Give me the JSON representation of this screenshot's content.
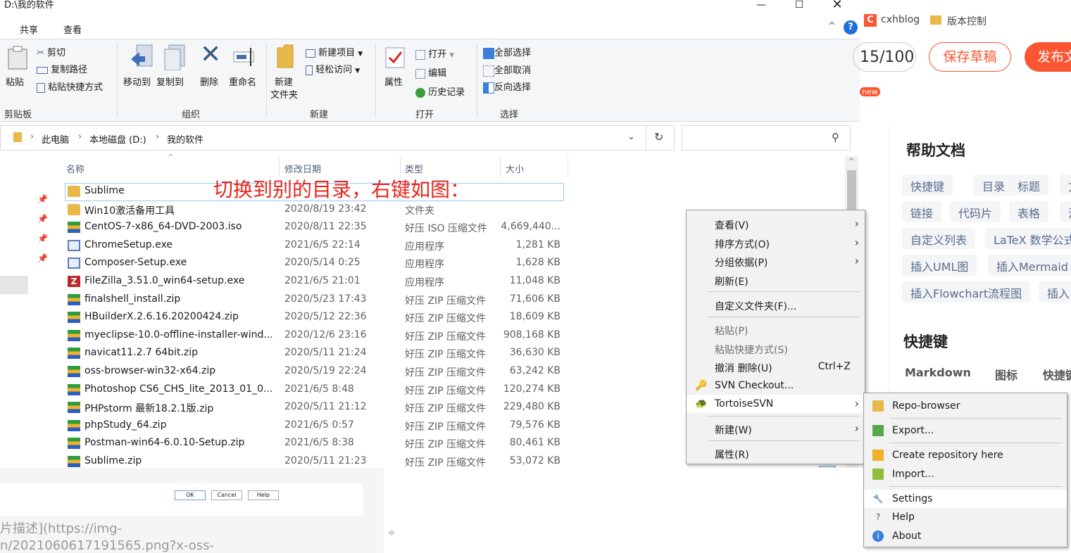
{
  "window": {
    "title": "D:\\我的软件",
    "min_icon": "minimize-icon",
    "max_icon": "maximize-icon",
    "close_icon": "close-icon"
  },
  "ribbon_tabs": [
    "共享",
    "查看"
  ],
  "ribbon": {
    "clipboard": {
      "paste": "粘贴",
      "cut": "剪切",
      "copy_path": "复制路径",
      "paste_shortcut": "粘贴快捷方式",
      "label": "剪贴板"
    },
    "organize": {
      "move_to": "移动到",
      "copy_to": "复制到",
      "delete": "删除",
      "rename": "重命名",
      "label": "组织"
    },
    "new": {
      "new_folder_l1": "新建",
      "new_folder_l2": "文件夹",
      "new_item": "新建项目",
      "easy_access": "轻松访问",
      "label": "新建"
    },
    "open": {
      "properties": "属性",
      "open": "打开",
      "edit": "编辑",
      "history": "历史记录",
      "label": "打开"
    },
    "select": {
      "select_all": "全部选择",
      "select_none": "全部取消",
      "invert": "反向选择",
      "label": "选择"
    }
  },
  "address": {
    "crumbs": [
      "此电脑",
      "本地磁盘 (D:)",
      "我的软件"
    ],
    "search_placeholder": ""
  },
  "columns": {
    "name": "名称",
    "date": "修改日期",
    "type": "类型",
    "size": "大小"
  },
  "annotation": "切换到别的目录，右键如图：",
  "files": [
    {
      "name": "Sublime",
      "date": "",
      "type": "",
      "size": "",
      "icon": "folder"
    },
    {
      "name": "Win10激活备用工具",
      "date": "2020/8/19 23:42",
      "type": "文件夹",
      "size": "",
      "icon": "folder"
    },
    {
      "name": "CentOS-7-x86_64-DVD-2003.iso",
      "date": "2020/8/11 22:35",
      "type": "好压 ISO 压缩文件",
      "size": "4,669,440...",
      "icon": "zip"
    },
    {
      "name": "ChromeSetup.exe",
      "date": "2021/6/5 22:14",
      "type": "应用程序",
      "size": "1,281 KB",
      "icon": "exe"
    },
    {
      "name": "Composer-Setup.exe",
      "date": "2020/5/14 0:25",
      "type": "应用程序",
      "size": "1,628 KB",
      "icon": "exe"
    },
    {
      "name": "FileZilla_3.51.0_win64-setup.exe",
      "date": "2021/6/5 21:01",
      "type": "应用程序",
      "size": "11,048 KB",
      "icon": "fz"
    },
    {
      "name": "finalshell_install.zip",
      "date": "2020/5/23 17:43",
      "type": "好压 ZIP 压缩文件",
      "size": "71,606 KB",
      "icon": "zip"
    },
    {
      "name": "HBuilderX.2.6.16.20200424.zip",
      "date": "2020/5/12 22:36",
      "type": "好压 ZIP 压缩文件",
      "size": "18,609 KB",
      "icon": "zip"
    },
    {
      "name": "myeclipse-10.0-offline-installer-wind...",
      "date": "2020/12/6 23:16",
      "type": "好压 ZIP 压缩文件",
      "size": "908,168 KB",
      "icon": "zip"
    },
    {
      "name": "navicat11.2.7 64bit.zip",
      "date": "2020/5/11 21:24",
      "type": "好压 ZIP 压缩文件",
      "size": "36,630 KB",
      "icon": "zip"
    },
    {
      "name": "oss-browser-win32-x64.zip",
      "date": "2020/5/19 22:24",
      "type": "好压 ZIP 压缩文件",
      "size": "63,242 KB",
      "icon": "zip"
    },
    {
      "name": "Photoshop CS6_CHS_lite_2013_01_0...",
      "date": "2021/6/5 8:48",
      "type": "好压 ZIP 压缩文件",
      "size": "120,274 KB",
      "icon": "zip"
    },
    {
      "name": "PHPstorm 最新18.2.1版.zip",
      "date": "2020/5/11 21:12",
      "type": "好压 ZIP 压缩文件",
      "size": "229,480 KB",
      "icon": "zip"
    },
    {
      "name": "phpStudy_64.zip",
      "date": "2021/6/5 0:57",
      "type": "好压 ZIP 压缩文件",
      "size": "79,576 KB",
      "icon": "zip"
    },
    {
      "name": "Postman-win64-6.0.10-Setup.zip",
      "date": "2021/6/5 8:38",
      "type": "好压 ZIP 压缩文件",
      "size": "80,461 KB",
      "icon": "zip"
    },
    {
      "name": "Sublime.zip",
      "date": "2020/5/11 21:23",
      "type": "好压 ZIP 压缩文件",
      "size": "53,072 KB",
      "icon": "zip"
    }
  ],
  "context_menu": {
    "view": "查看(V)",
    "sort": "排序方式(O)",
    "group": "分组依据(P)",
    "refresh": "刷新(E)",
    "customize": "自定义文件夹(F)...",
    "paste": "粘贴(P)",
    "paste_shortcut": "粘贴快捷方式(S)",
    "undo_delete": "撤消 删除(U)",
    "undo_shortcut": "Ctrl+Z",
    "svn_checkout": "SVN Checkout...",
    "tortoise": "TortoiseSVN",
    "new": "新建(W)",
    "properties": "属性(R)"
  },
  "submenu": {
    "repo_browser": "Repo-browser",
    "export": "Export...",
    "create_repo": "Create repository here",
    "import": "Import...",
    "settings": "Settings",
    "help": "Help",
    "about": "About"
  },
  "browser": {
    "bookmark1": "cxhblog",
    "bookmark2": "版本控制",
    "word_count": "15/100",
    "save_draft": "保存草稿",
    "publish": "发布文",
    "new_badge": "new",
    "help_title": "帮助文档",
    "help_tags": [
      "快捷键",
      "目录",
      "标题",
      "文",
      "链接",
      "代码片",
      "表格",
      "注",
      "自定义列表",
      "LaTeX 数学公式",
      "插入UML图",
      "插入Mermaid",
      "插入Flowchart流程图",
      "插入"
    ],
    "shortcut_title": "快捷键",
    "shortcut_cols": [
      "Markdown",
      "图标",
      "快捷键"
    ]
  },
  "bottom": {
    "line1": "片描述](https://img-",
    "line2": "n/2021060617191565.png?x-oss-",
    "ok": "OK",
    "cancel": "Cancel",
    "help": "Help"
  },
  "colors": {
    "accent_red": "#fc5531",
    "annotation_red": "#e8261c",
    "link_blue": "#4c607a"
  }
}
